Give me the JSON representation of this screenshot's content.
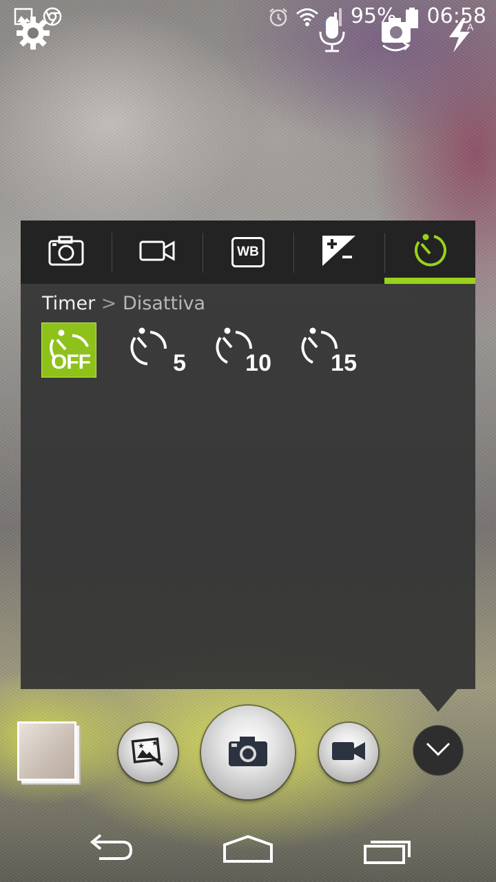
{
  "status_bar": {
    "battery": "95%",
    "time": "06:58",
    "icons": [
      "gallery-notification-icon",
      "chrome-icon",
      "alarm-icon",
      "wifi-icon",
      "signal-icon",
      "battery-icon"
    ]
  },
  "top_controls": [
    "settings-gear-icon",
    "voice-microphone-icon",
    "switch-camera-icon",
    "flash-auto-icon"
  ],
  "panel": {
    "tabs": [
      {
        "name": "photo-settings",
        "icon": "camera-icon"
      },
      {
        "name": "video-settings",
        "icon": "video-camera-icon"
      },
      {
        "name": "white-balance",
        "icon": "wb-icon",
        "label": "WB"
      },
      {
        "name": "exposure",
        "icon": "exposure-icon"
      },
      {
        "name": "timer",
        "icon": "timer-icon",
        "active": true
      }
    ],
    "breadcrumb": {
      "main": "Timer",
      "separator": ">",
      "sub": "Disattiva"
    },
    "timer_options": [
      {
        "label": "OFF",
        "selected": true
      },
      {
        "label": "5",
        "selected": false
      },
      {
        "label": "10",
        "selected": false
      },
      {
        "label": "15",
        "selected": false
      }
    ],
    "accent_color": "#9ad11c"
  },
  "bottom_bar": [
    "gallery-thumbnail",
    "photo-effects-button",
    "shutter-button",
    "video-record-button",
    "expand-menu-button"
  ],
  "nav_bar": [
    "back-icon",
    "home-icon",
    "recent-apps-icon"
  ]
}
